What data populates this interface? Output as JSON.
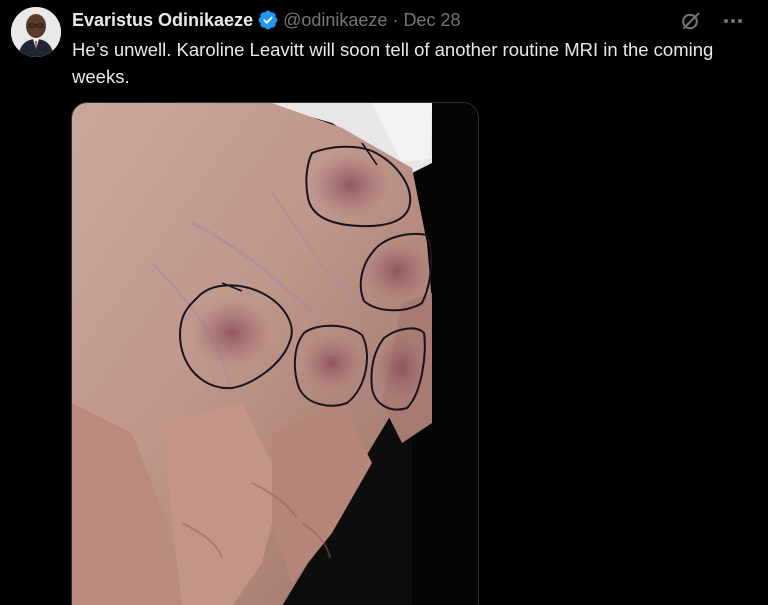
{
  "tweet": {
    "display_name": "Evaristus Odinikaeze",
    "handle": "@odinikaeze",
    "separator": "·",
    "date": "Dec 28",
    "text": "He’s unwell. Karoline Leavitt will soon tell of another routine MRI in the coming weeks.",
    "verified": true,
    "media_alt": "Photo of a hand with bruised patches circled in black ink"
  },
  "icons": {
    "verified": "verified-badge-icon",
    "grok": "grok-icon",
    "more": "more-icon"
  },
  "colors": {
    "background": "#000000",
    "text_primary": "#e7e9ea",
    "text_secondary": "#71767b",
    "verified_blue": "#1d9bf0"
  }
}
